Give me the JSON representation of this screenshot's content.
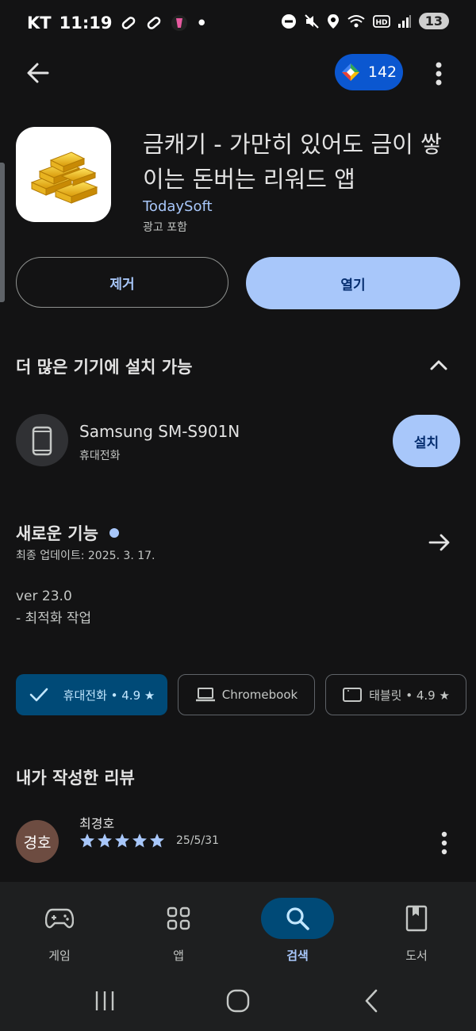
{
  "status_bar": {
    "carrier": "KT",
    "time": "11:19",
    "battery": "13",
    "dot": "•"
  },
  "header": {
    "points": "142"
  },
  "app": {
    "title": "금캐기 - 가만히 있어도 금이 쌓이는 돈버는 리워드 앱",
    "developer": "TodaySoft",
    "ads_note": "광고 포함",
    "remove_label": "제거",
    "open_label": "열기"
  },
  "devices": {
    "section_title": "더 많은 기기에 설치 가능",
    "device_name": "Samsung SM-S901N",
    "device_type": "휴대전화",
    "install_label": "설치"
  },
  "whats_new": {
    "title": "새로운 기능",
    "updated": "최종 업데이트: 2025. 3. 17.",
    "version": "ver 23.0",
    "note": "- 최적화 작업"
  },
  "chips": [
    {
      "label": "휴대전화 • 4.9 ★"
    },
    {
      "label": "Chromebook"
    },
    {
      "label": "태블릿 • 4.9 ★"
    }
  ],
  "review": {
    "section_title": "내가 작성한 리뷰",
    "avatar_text": "경호",
    "author": "최경호",
    "rating": 5,
    "date": "25/5/31"
  },
  "bottom_nav": [
    {
      "label": "게임"
    },
    {
      "label": "앱"
    },
    {
      "label": "검색"
    },
    {
      "label": "도서"
    }
  ],
  "colors": {
    "accent": "#a8c7fa",
    "background": "#131314",
    "active_chip": "#004a77"
  }
}
